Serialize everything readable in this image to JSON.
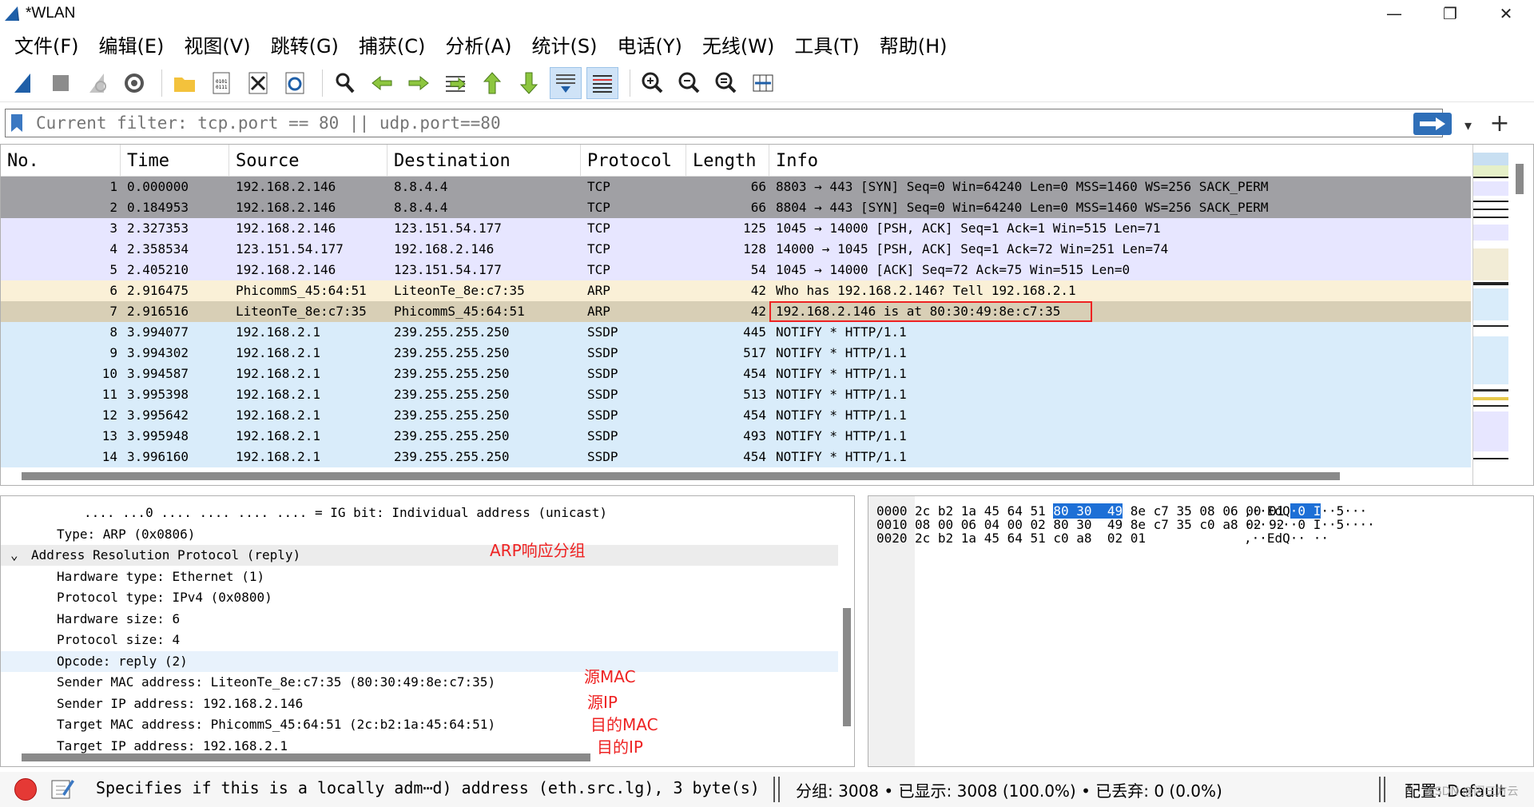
{
  "window": {
    "title": "*WLAN",
    "controls": [
      "—",
      "❐",
      "✕"
    ]
  },
  "menu": [
    "文件(F)",
    "编辑(E)",
    "视图(V)",
    "跳转(G)",
    "捕获(C)",
    "分析(A)",
    "统计(S)",
    "电话(Y)",
    "无线(W)",
    "工具(T)",
    "帮助(H)"
  ],
  "toolbar": {
    "icons": [
      "shark-fin-icon",
      "stop-icon",
      "restart-icon",
      "gear-icon",
      "open-folder-icon",
      "file-icon",
      "close-file-icon",
      "reload-icon",
      "find-icon",
      "back-arrow-icon",
      "forward-arrow-icon",
      "goto-packet-icon",
      "first-packet-icon",
      "last-packet-icon",
      "autoscroll-icon",
      "colorize-icon",
      "zoom-in-icon",
      "zoom-out-icon",
      "zoom-normal-icon",
      "resize-columns-icon"
    ]
  },
  "filter": {
    "placeholder": "Current filter: tcp.port == 80 || udp.port==80",
    "value": ""
  },
  "packet_list": {
    "columns": [
      "No.",
      "Time",
      "Source",
      "Destination",
      "Protocol",
      "Length",
      "Info"
    ],
    "rows": [
      {
        "no": "1",
        "time": "0.000000",
        "src": "192.168.2.146",
        "dst": "8.8.4.4",
        "proto": "TCP",
        "len": "66",
        "info": "8803 → 443 [SYN] Seq=0 Win=64240 Len=0 MSS=1460 WS=256 SACK_PERM",
        "color": "gray"
      },
      {
        "no": "2",
        "time": "0.184953",
        "src": "192.168.2.146",
        "dst": "8.8.4.4",
        "proto": "TCP",
        "len": "66",
        "info": "8804 → 443 [SYN] Seq=0 Win=64240 Len=0 MSS=1460 WS=256 SACK_PERM",
        "color": "gray"
      },
      {
        "no": "3",
        "time": "2.327353",
        "src": "192.168.2.146",
        "dst": "123.151.54.177",
        "proto": "TCP",
        "len": "125",
        "info": "1045 → 14000 [PSH, ACK] Seq=1 Ack=1 Win=515 Len=71",
        "color": "lav"
      },
      {
        "no": "4",
        "time": "2.358534",
        "src": "123.151.54.177",
        "dst": "192.168.2.146",
        "proto": "TCP",
        "len": "128",
        "info": "14000 → 1045 [PSH, ACK] Seq=1 Ack=72 Win=251 Len=74",
        "color": "lav"
      },
      {
        "no": "5",
        "time": "2.405210",
        "src": "192.168.2.146",
        "dst": "123.151.54.177",
        "proto": "TCP",
        "len": "54",
        "info": "1045 → 14000 [ACK] Seq=72 Ack=75 Win=515 Len=0",
        "color": "lav"
      },
      {
        "no": "6",
        "time": "2.916475",
        "src": "PhicommS_45:64:51",
        "dst": "LiteonTe_8e:c7:35",
        "proto": "ARP",
        "len": "42",
        "info": "Who has 192.168.2.146? Tell 192.168.2.1",
        "color": "cream"
      },
      {
        "no": "7",
        "time": "2.916516",
        "src": "LiteonTe_8e:c7:35",
        "dst": "PhicommS_45:64:51",
        "proto": "ARP",
        "len": "42",
        "info": "192.168.2.146 is at 80:30:49:8e:c7:35",
        "color": "tan",
        "boxed": true
      },
      {
        "no": "8",
        "time": "3.994077",
        "src": "192.168.2.1",
        "dst": "239.255.255.250",
        "proto": "SSDP",
        "len": "445",
        "info": "NOTIFY * HTTP/1.1",
        "color": "blue"
      },
      {
        "no": "9",
        "time": "3.994302",
        "src": "192.168.2.1",
        "dst": "239.255.255.250",
        "proto": "SSDP",
        "len": "517",
        "info": "NOTIFY * HTTP/1.1",
        "color": "blue"
      },
      {
        "no": "10",
        "time": "3.994587",
        "src": "192.168.2.1",
        "dst": "239.255.255.250",
        "proto": "SSDP",
        "len": "454",
        "info": "NOTIFY * HTTP/1.1",
        "color": "blue"
      },
      {
        "no": "11",
        "time": "3.995398",
        "src": "192.168.2.1",
        "dst": "239.255.255.250",
        "proto": "SSDP",
        "len": "513",
        "info": "NOTIFY * HTTP/1.1",
        "color": "blue"
      },
      {
        "no": "12",
        "time": "3.995642",
        "src": "192.168.2.1",
        "dst": "239.255.255.250",
        "proto": "SSDP",
        "len": "454",
        "info": "NOTIFY * HTTP/1.1",
        "color": "blue"
      },
      {
        "no": "13",
        "time": "3.995948",
        "src": "192.168.2.1",
        "dst": "239.255.255.250",
        "proto": "SSDP",
        "len": "493",
        "info": "NOTIFY * HTTP/1.1",
        "color": "blue"
      },
      {
        "no": "14",
        "time": "3.996160",
        "src": "192.168.2.1",
        "dst": "239.255.255.250",
        "proto": "SSDP",
        "len": "454",
        "info": "NOTIFY * HTTP/1.1",
        "color": "blue"
      }
    ]
  },
  "details": {
    "lines": [
      {
        "text": ".... ...0 .... .... .... .... = IG bit: Individual address (unicast)",
        "indent": 2
      },
      {
        "text": "Type: ARP (0x0806)",
        "indent": 1
      },
      {
        "text": "Address Resolution Protocol (reply)",
        "indent": 0,
        "expander": "⌄",
        "section": true
      },
      {
        "text": "Hardware type: Ethernet (1)",
        "indent": 1
      },
      {
        "text": "Protocol type: IPv4 (0x0800)",
        "indent": 1
      },
      {
        "text": "Hardware size: 6",
        "indent": 1
      },
      {
        "text": "Protocol size: 4",
        "indent": 1
      },
      {
        "text": "Opcode: reply (2)",
        "indent": 1,
        "selected": true
      },
      {
        "text": "Sender MAC address: LiteonTe_8e:c7:35 (80:30:49:8e:c7:35)",
        "indent": 1
      },
      {
        "text": "Sender IP address: 192.168.2.146",
        "indent": 1
      },
      {
        "text": "Target MAC address: PhicommS_45:64:51 (2c:b2:1a:45:64:51)",
        "indent": 1
      },
      {
        "text": "Target IP address: 192.168.2.1",
        "indent": 1
      }
    ],
    "annotations": [
      "ARP响应分组",
      "源MAC",
      "源IP",
      "目的MAC",
      "目的IP"
    ]
  },
  "bytes": {
    "rows": [
      {
        "offset": "0000",
        "hex_pre": "2c b2 1a 45 64 51 ",
        "hex_hl": "80 30  49",
        "hex_post": " 8e c7 35 08 06 00 01",
        "ascii_pre": ",··EdQ",
        "ascii_hl": "·0 I",
        "ascii_post": "··5···"
      },
      {
        "offset": "0010",
        "hex_pre": "08 00 06 04 00 02 80 30  49 8e c7 35 c0 a8 02 92",
        "hex_hl": "",
        "hex_post": "",
        "ascii_pre": "·······0 I··5····",
        "ascii_hl": "",
        "ascii_post": ""
      },
      {
        "offset": "0020",
        "hex_pre": "2c b2 1a 45 64 51 c0 a8  02 01",
        "hex_hl": "",
        "hex_post": "",
        "ascii_pre": ",··EdQ·· ··",
        "ascii_hl": "",
        "ascii_post": ""
      }
    ]
  },
  "status": {
    "text": "Specifies if this is a locally adm⋯d) address (eth.src.lg), 3 byte(s)",
    "stats": "分组: 3008 • 已显示: 3008 (100.0%) • 已丢弃: 0 (0.0%)",
    "profile": "配置: Default",
    "watermark": "CSDN @闪三方云"
  },
  "colors": {
    "accent": "#1d6fd6",
    "annotation": "#e22222"
  }
}
